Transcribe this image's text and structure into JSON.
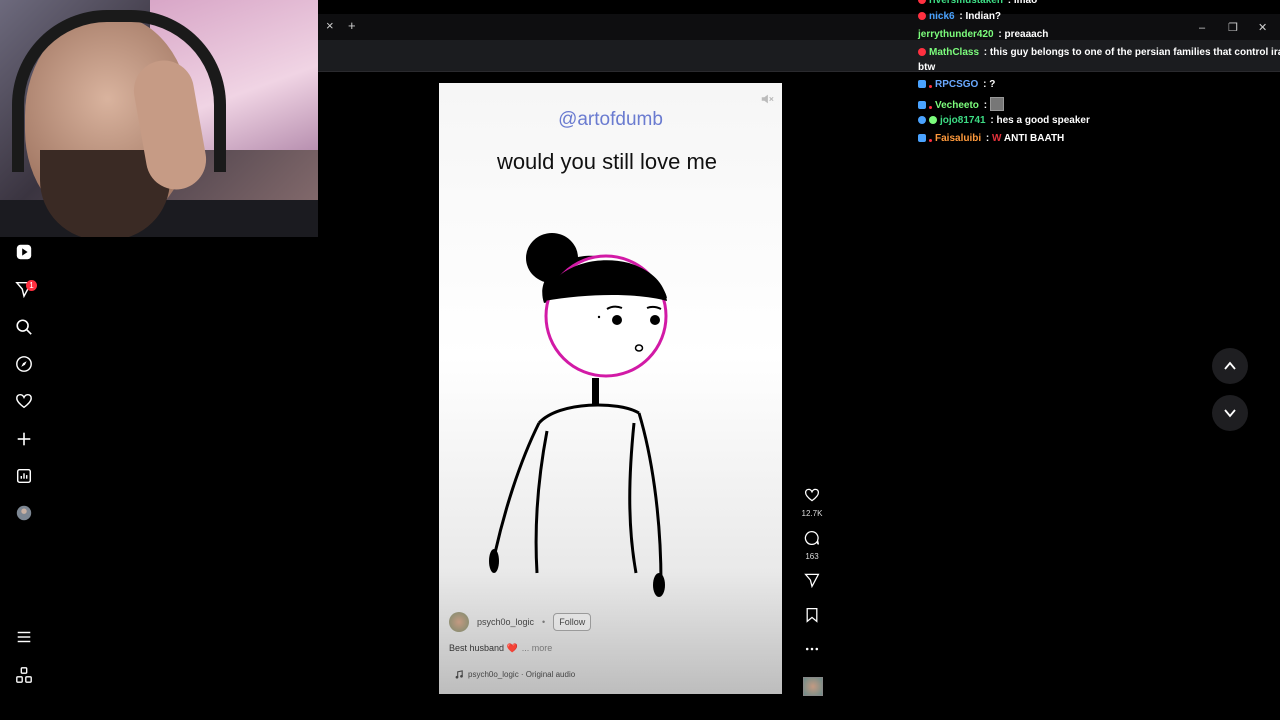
{
  "browser": {
    "tab_close": "×",
    "new_tab": "+",
    "window_controls": [
      "–",
      "❐",
      "✕"
    ]
  },
  "sidebar": {
    "items": [
      {
        "name": "reels-icon"
      },
      {
        "name": "messages-icon",
        "badge": "1"
      },
      {
        "name": "search-icon"
      },
      {
        "name": "explore-icon"
      },
      {
        "name": "notifications-icon"
      },
      {
        "name": "create-icon"
      },
      {
        "name": "dashboard-icon"
      },
      {
        "name": "profile-avatar"
      },
      {
        "name": "menu-icon"
      },
      {
        "name": "meta-icon"
      }
    ]
  },
  "reel": {
    "handle": "@artofdumb",
    "caption": "would you still love me",
    "author": "psych0o_logic",
    "separator": "•",
    "follow_label": "Follow",
    "description": "Best husband ❤️",
    "more_label": "... more",
    "audio_label": "psych0o_logic · Original audio",
    "likes": "12.7K",
    "comments": "163"
  },
  "chat": {
    "messages": [
      {
        "user": "riversmustaken",
        "text": "lmao",
        "color": "#3ddc84"
      },
      {
        "user": "nick6",
        "text": "Indian?",
        "color": "#4aa3ff"
      },
      {
        "user": "jerrythunder420",
        "text": "preaaach",
        "color": "#7cfc7c"
      },
      {
        "user": "MathClass",
        "text": "this guy belongs to one of the persian families that control iraq",
        "color": "#7cfc7c"
      },
      {
        "user": "",
        "text": "btw",
        "color": "#fff"
      },
      {
        "user": "RPCSGO",
        "text": "?",
        "color": "#6aa9ff"
      },
      {
        "user": "Vecheeto",
        "text": "",
        "color": "#7cfc7c"
      },
      {
        "user": "jojo81741",
        "text": "hes a good speaker",
        "color": "#3ddc84"
      },
      {
        "user": "Faisaluibi",
        "text": "ANTI BAATH",
        "color": "#ff9a3c"
      }
    ],
    "separator": ":",
    "emote_w": "W"
  },
  "colors": {
    "circle_face": "#d21aa6",
    "handle": "#6a7bd0",
    "badge_red": "#ff3040"
  }
}
